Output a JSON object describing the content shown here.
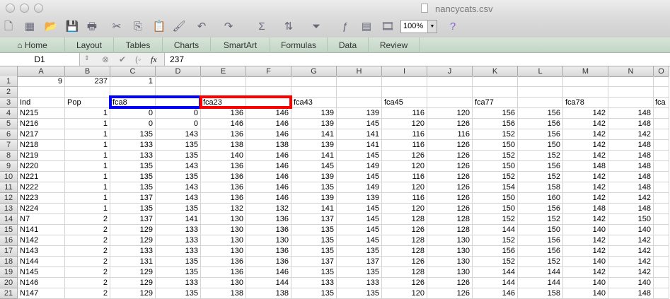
{
  "window": {
    "title": "nancycats.csv"
  },
  "toolbar": {
    "zoom": "100%",
    "icons": [
      "new-icon",
      "gallery-icon",
      "open-icon",
      "save-icon",
      "print-icon",
      "cut-icon",
      "copy-icon",
      "paste-icon",
      "format-painter-icon",
      "undo-icon",
      "redo-icon",
      "autosum-icon",
      "sort-icon",
      "filter-icon",
      "function-icon",
      "formula-builder-icon",
      "media-icon"
    ]
  },
  "ribbon": {
    "tabs": [
      "Home",
      "Layout",
      "Tables",
      "Charts",
      "SmartArt",
      "Formulas",
      "Data",
      "Review"
    ]
  },
  "formula_bar": {
    "name_box": "D1",
    "value": "237"
  },
  "sheet": {
    "columns": [
      "A",
      "B",
      "C",
      "D",
      "E",
      "F",
      "G",
      "H",
      "I",
      "J",
      "K",
      "L",
      "M",
      "N",
      "O"
    ],
    "rows": [
      [
        "9",
        "237",
        "1",
        "",
        "",
        "",
        "",
        "",
        "",
        "",
        "",
        "",
        "",
        "",
        ""
      ],
      [
        "",
        "",
        "",
        "",
        "",
        "",
        "",
        "",
        "",
        "",
        "",
        "",
        "",
        "",
        ""
      ],
      [
        "Ind",
        "Pop",
        "fca8",
        "",
        "fca23",
        "",
        "fca43",
        "",
        "fca45",
        "",
        "fca77",
        "",
        "fca78",
        "",
        "fca"
      ],
      [
        "N215",
        "1",
        "0",
        "0",
        "136",
        "146",
        "139",
        "139",
        "116",
        "120",
        "156",
        "156",
        "142",
        "148",
        ""
      ],
      [
        "N216",
        "1",
        "0",
        "0",
        "146",
        "146",
        "139",
        "145",
        "120",
        "126",
        "156",
        "156",
        "142",
        "148",
        ""
      ],
      [
        "N217",
        "1",
        "135",
        "143",
        "136",
        "146",
        "141",
        "141",
        "116",
        "116",
        "152",
        "156",
        "142",
        "142",
        ""
      ],
      [
        "N218",
        "1",
        "133",
        "135",
        "138",
        "138",
        "139",
        "141",
        "116",
        "126",
        "150",
        "150",
        "142",
        "148",
        ""
      ],
      [
        "N219",
        "1",
        "133",
        "135",
        "140",
        "146",
        "141",
        "145",
        "126",
        "126",
        "152",
        "152",
        "142",
        "148",
        ""
      ],
      [
        "N220",
        "1",
        "135",
        "143",
        "136",
        "146",
        "145",
        "149",
        "120",
        "126",
        "150",
        "156",
        "148",
        "148",
        ""
      ],
      [
        "N221",
        "1",
        "135",
        "135",
        "136",
        "146",
        "139",
        "145",
        "116",
        "126",
        "152",
        "152",
        "142",
        "148",
        ""
      ],
      [
        "N222",
        "1",
        "135",
        "143",
        "136",
        "146",
        "135",
        "149",
        "120",
        "126",
        "154",
        "158",
        "142",
        "148",
        ""
      ],
      [
        "N223",
        "1",
        "137",
        "143",
        "136",
        "146",
        "139",
        "139",
        "116",
        "126",
        "150",
        "160",
        "142",
        "142",
        ""
      ],
      [
        "N224",
        "1",
        "135",
        "135",
        "132",
        "132",
        "141",
        "145",
        "120",
        "126",
        "150",
        "156",
        "148",
        "148",
        ""
      ],
      [
        "N7",
        "2",
        "137",
        "141",
        "130",
        "136",
        "137",
        "145",
        "128",
        "128",
        "152",
        "152",
        "142",
        "150",
        ""
      ],
      [
        "N141",
        "2",
        "129",
        "133",
        "130",
        "136",
        "135",
        "145",
        "126",
        "128",
        "144",
        "150",
        "140",
        "140",
        ""
      ],
      [
        "N142",
        "2",
        "129",
        "133",
        "130",
        "130",
        "135",
        "145",
        "128",
        "130",
        "152",
        "156",
        "142",
        "142",
        ""
      ],
      [
        "N143",
        "2",
        "133",
        "133",
        "130",
        "136",
        "135",
        "135",
        "128",
        "130",
        "156",
        "156",
        "142",
        "142",
        ""
      ],
      [
        "N144",
        "2",
        "131",
        "135",
        "136",
        "136",
        "137",
        "137",
        "126",
        "130",
        "152",
        "152",
        "140",
        "142",
        ""
      ],
      [
        "N145",
        "2",
        "129",
        "135",
        "136",
        "146",
        "135",
        "135",
        "128",
        "130",
        "144",
        "144",
        "142",
        "142",
        ""
      ],
      [
        "N146",
        "2",
        "129",
        "133",
        "130",
        "144",
        "133",
        "133",
        "126",
        "126",
        "144",
        "144",
        "140",
        "140",
        ""
      ],
      [
        "N147",
        "2",
        "129",
        "135",
        "138",
        "138",
        "135",
        "135",
        "120",
        "126",
        "146",
        "158",
        "140",
        "148",
        ""
      ]
    ]
  },
  "highlights": {
    "blue": "#0000ff",
    "red": "#ff0000"
  }
}
